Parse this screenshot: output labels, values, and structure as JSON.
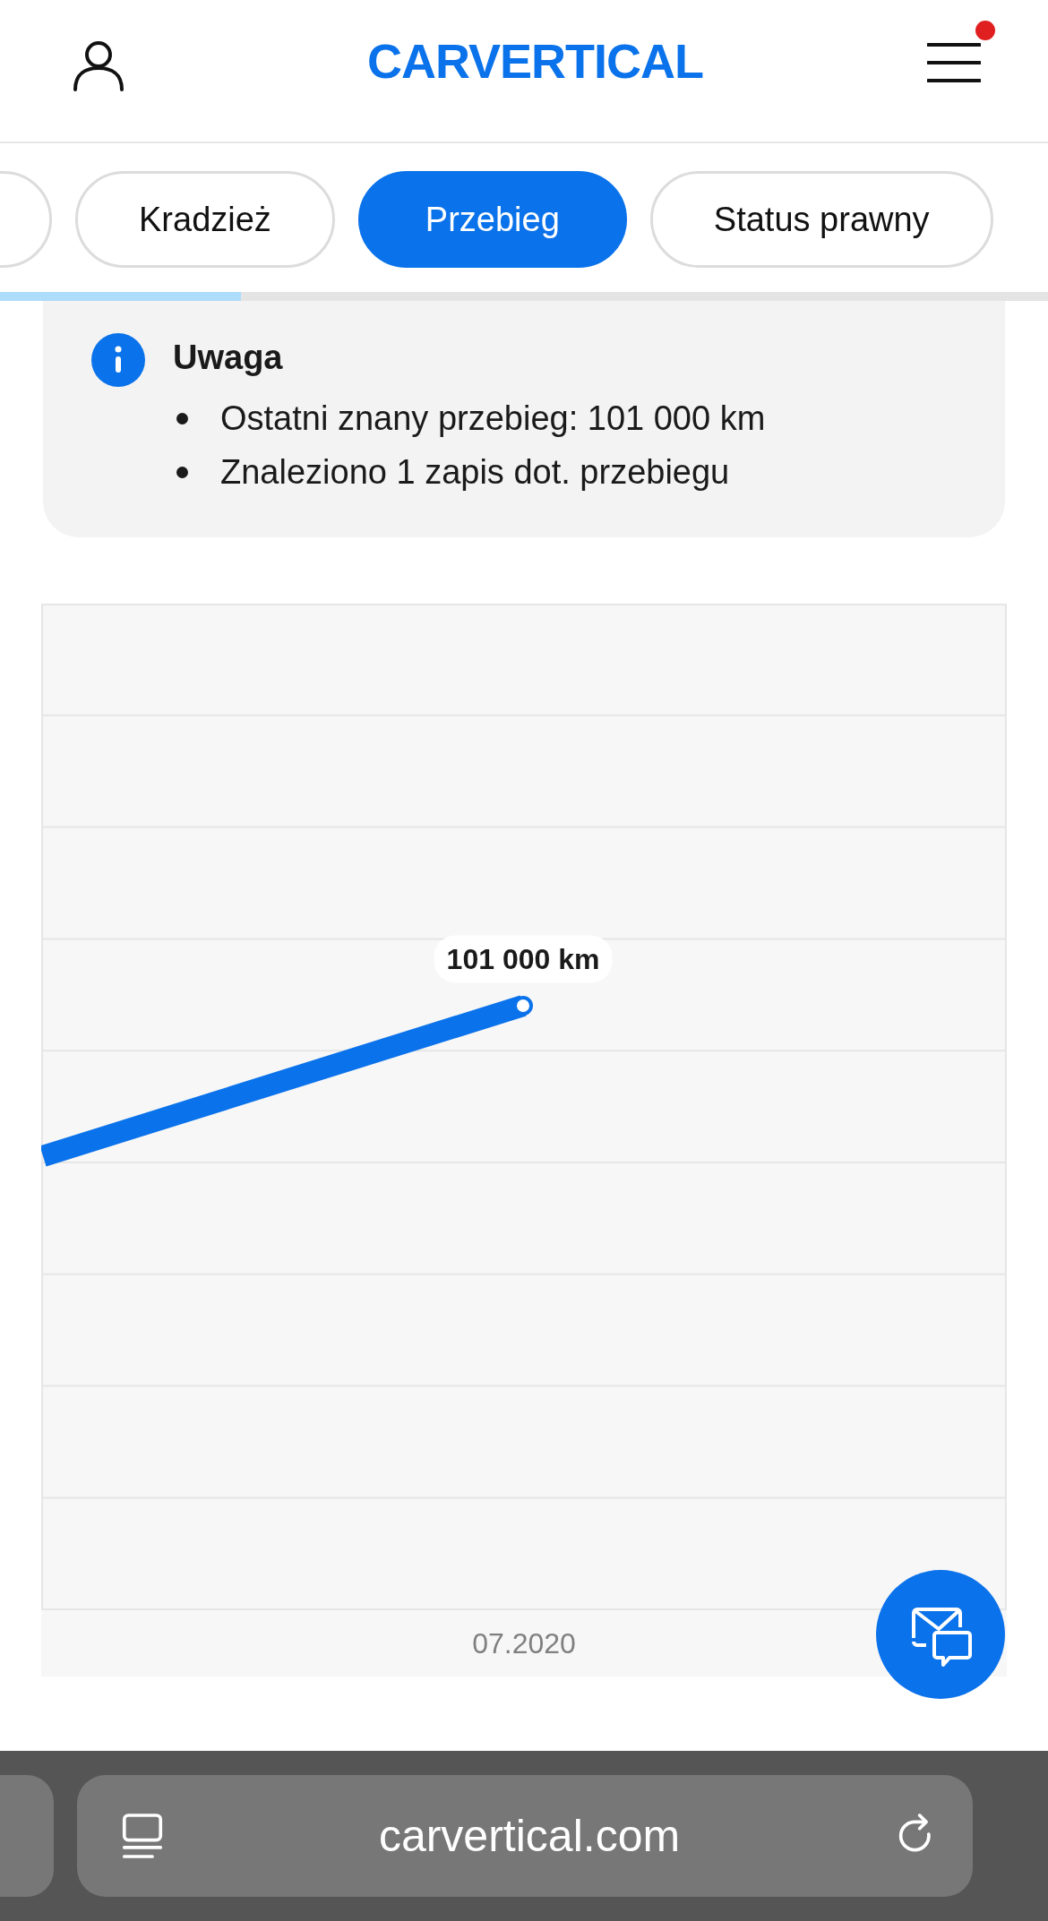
{
  "header": {
    "logo": "CARVERTICAL",
    "notification_dot": true
  },
  "tabs": [
    {
      "label": "Kradzież",
      "selected": false
    },
    {
      "label": "Przebieg",
      "selected": true
    },
    {
      "label": "Status prawny",
      "selected": false
    }
  ],
  "scroll_progress": {
    "level": 0.23
  },
  "notice": {
    "title": "Uwaga",
    "items": [
      "Ostatni znany przebieg: 101 000 km",
      "Znaleziono 1 zapis dot. przebiegu"
    ]
  },
  "mileage_chart": {
    "point_label": "101 000 km",
    "x_label": "07.2020"
  },
  "browser": {
    "url": "carvertical.com"
  }
}
